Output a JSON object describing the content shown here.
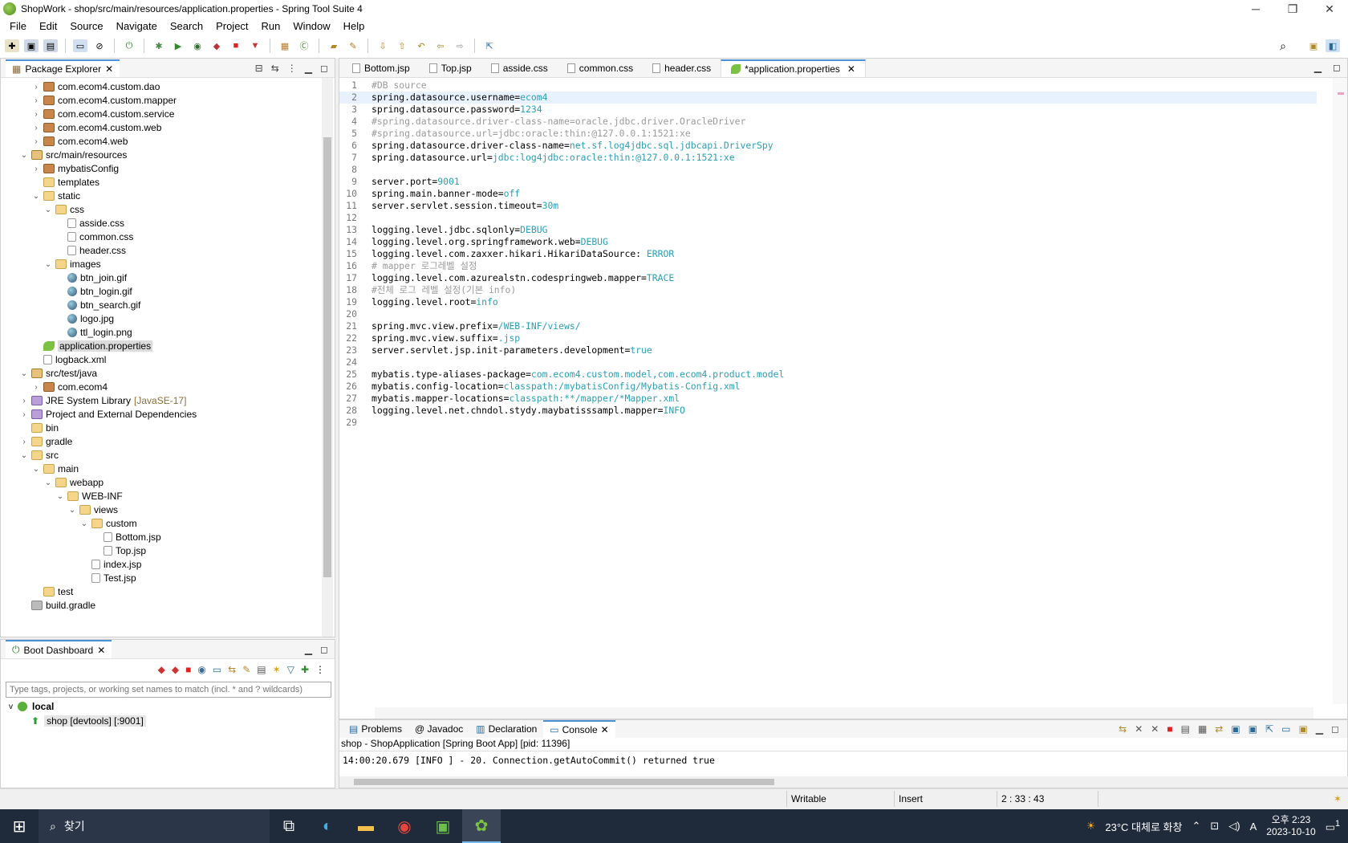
{
  "window": {
    "title": "ShopWork - shop/src/main/resources/application.properties - Spring Tool Suite 4",
    "minimize": "─",
    "maximize": "❐",
    "close": "✕"
  },
  "menu": [
    "File",
    "Edit",
    "Source",
    "Navigate",
    "Search",
    "Project",
    "Run",
    "Window",
    "Help"
  ],
  "package_explorer": {
    "title": "Package Explorer",
    "tree": [
      {
        "indent": 1,
        "twisty": ">",
        "icon": "package-icon",
        "label": "com.ecom4.custom.dao"
      },
      {
        "indent": 1,
        "twisty": ">",
        "icon": "package-icon",
        "label": "com.ecom4.custom.mapper"
      },
      {
        "indent": 1,
        "twisty": ">",
        "icon": "package-icon",
        "label": "com.ecom4.custom.service"
      },
      {
        "indent": 1,
        "twisty": ">",
        "icon": "package-icon",
        "label": "com.ecom4.custom.web"
      },
      {
        "indent": 1,
        "twisty": ">",
        "icon": "package-icon",
        "label": "com.ecom4.web"
      },
      {
        "indent": 0,
        "twisty": "v",
        "icon": "source-folder-icon",
        "label": "src/main/resources"
      },
      {
        "indent": 1,
        "twisty": ">",
        "icon": "package-icon",
        "label": "mybatisConfig"
      },
      {
        "indent": 1,
        "twisty": "",
        "icon": "folder-icon",
        "label": "templates"
      },
      {
        "indent": 1,
        "twisty": "v",
        "icon": "folder-icon",
        "label": "static"
      },
      {
        "indent": 2,
        "twisty": "v",
        "icon": "folder-icon",
        "label": "css"
      },
      {
        "indent": 3,
        "twisty": "",
        "icon": "file-icon",
        "label": "asside.css"
      },
      {
        "indent": 3,
        "twisty": "",
        "icon": "file-icon",
        "label": "common.css"
      },
      {
        "indent": 3,
        "twisty": "",
        "icon": "file-icon",
        "label": "header.css"
      },
      {
        "indent": 2,
        "twisty": "v",
        "icon": "folder-icon",
        "label": "images"
      },
      {
        "indent": 3,
        "twisty": "",
        "icon": "image-icon",
        "label": "btn_join.gif"
      },
      {
        "indent": 3,
        "twisty": "",
        "icon": "image-icon",
        "label": "btn_login.gif"
      },
      {
        "indent": 3,
        "twisty": "",
        "icon": "image-icon",
        "label": "btn_search.gif"
      },
      {
        "indent": 3,
        "twisty": "",
        "icon": "image-icon",
        "label": "logo.jpg"
      },
      {
        "indent": 3,
        "twisty": "",
        "icon": "image-icon",
        "label": "ttl_login.png"
      },
      {
        "indent": 1,
        "twisty": "",
        "icon": "properties-icon",
        "label": "application.properties",
        "selected": true
      },
      {
        "indent": 1,
        "twisty": "",
        "icon": "xml-icon",
        "label": "logback.xml"
      },
      {
        "indent": 0,
        "twisty": "v",
        "icon": "source-folder-icon",
        "label": "src/test/java"
      },
      {
        "indent": 1,
        "twisty": ">",
        "icon": "package-icon",
        "label": "com.ecom4"
      },
      {
        "indent": 0,
        "twisty": ">",
        "icon": "library-icon",
        "label": "JRE System Library",
        "suffix": "[JavaSE-17]"
      },
      {
        "indent": 0,
        "twisty": ">",
        "icon": "library-icon",
        "label": "Project and External Dependencies"
      },
      {
        "indent": 0,
        "twisty": "",
        "icon": "folder-icon",
        "label": "bin"
      },
      {
        "indent": 0,
        "twisty": ">",
        "icon": "folder-icon",
        "label": "gradle"
      },
      {
        "indent": 0,
        "twisty": "v",
        "icon": "folder-icon",
        "label": "src"
      },
      {
        "indent": 1,
        "twisty": "v",
        "icon": "folder-icon",
        "label": "main"
      },
      {
        "indent": 2,
        "twisty": "v",
        "icon": "folder-icon",
        "label": "webapp"
      },
      {
        "indent": 3,
        "twisty": "v",
        "icon": "folder-icon",
        "label": "WEB-INF"
      },
      {
        "indent": 4,
        "twisty": "v",
        "icon": "folder-icon",
        "label": "views"
      },
      {
        "indent": 5,
        "twisty": "v",
        "icon": "folder-icon",
        "label": "custom"
      },
      {
        "indent": 6,
        "twisty": "",
        "icon": "file-icon",
        "label": "Bottom.jsp"
      },
      {
        "indent": 6,
        "twisty": "",
        "icon": "file-icon",
        "label": "Top.jsp"
      },
      {
        "indent": 5,
        "twisty": "",
        "icon": "file-icon",
        "label": "index.jsp"
      },
      {
        "indent": 5,
        "twisty": "",
        "icon": "file-icon",
        "label": "Test.jsp"
      },
      {
        "indent": 1,
        "twisty": "",
        "icon": "folder-icon",
        "label": "test"
      },
      {
        "indent": 0,
        "twisty": "",
        "icon": "config-icon",
        "label": "build.gradle"
      }
    ]
  },
  "boot_dashboard": {
    "title": "Boot Dashboard",
    "filter_placeholder": "Type tags, projects, or working set names to match (incl. * and ? wildcards)",
    "local_label": "local",
    "app_label": "shop [devtools] [:9001]"
  },
  "editor": {
    "tabs": [
      {
        "label": "Bottom.jsp",
        "active": false
      },
      {
        "label": "Top.jsp",
        "active": false
      },
      {
        "label": "asside.css",
        "active": false
      },
      {
        "label": "common.css",
        "active": false
      },
      {
        "label": "header.css",
        "active": false
      },
      {
        "label": "*application.properties",
        "active": true
      }
    ],
    "lines": [
      {
        "n": "1",
        "comment": "#DB source"
      },
      {
        "n": "2",
        "key": "spring.datasource.username=",
        "value": "ecom4",
        "current": true
      },
      {
        "n": "3",
        "key": "spring.datasource.password=",
        "value": "1234"
      },
      {
        "n": "4",
        "comment": "#spring.datasource.driver-class-name=oracle.jdbc.driver.OracleDriver"
      },
      {
        "n": "5",
        "comment": "#spring.datasource.url=jdbc:oracle:thin:@127.0.0.1:1521:xe"
      },
      {
        "n": "6",
        "key": "spring.datasource.driver-class-name=",
        "value": "net.sf.log4jdbc.sql.jdbcapi.DriverSpy"
      },
      {
        "n": "7",
        "key": "spring.datasource.url=",
        "value": "jdbc:log4jdbc:oracle:thin:@127.0.0.1:1521:xe"
      },
      {
        "n": "8"
      },
      {
        "n": "9",
        "key": "server.port=",
        "value": "9001"
      },
      {
        "n": "10",
        "key": "spring.main.banner-mode=",
        "value": "off"
      },
      {
        "n": "11",
        "key": "server.servlet.session.timeout=",
        "value": "30m"
      },
      {
        "n": "12"
      },
      {
        "n": "13",
        "key": "logging.level.jdbc.sqlonly=",
        "value": "DEBUG"
      },
      {
        "n": "14",
        "key": "logging.level.org.springframework.web=",
        "value": "DEBUG"
      },
      {
        "n": "15",
        "key": "logging.level.com.zaxxer.hikari.HikariDataSource: ",
        "value": "ERROR"
      },
      {
        "n": "16",
        "comment": "# mapper 로그레벨 설정"
      },
      {
        "n": "17",
        "key": "logging.level.com.azurealstn.codespringweb.mapper=",
        "value": "TRACE"
      },
      {
        "n": "18",
        "comment": "#전체 로그 레벨 설정(기본 info)"
      },
      {
        "n": "19",
        "key": "logging.level.root=",
        "value": "info"
      },
      {
        "n": "20"
      },
      {
        "n": "21",
        "key": "spring.mvc.view.prefix=",
        "value": "/WEB-INF/views/"
      },
      {
        "n": "22",
        "key": "spring.mvc.view.suffix=",
        "value": ".jsp"
      },
      {
        "n": "23",
        "key": "server.servlet.jsp.init-parameters.development=",
        "value": "true"
      },
      {
        "n": "24"
      },
      {
        "n": "25",
        "key": "mybatis.type-aliases-package=",
        "value": "com.ecom4.custom.model,com.ecom4.product.model"
      },
      {
        "n": "26",
        "key": "mybatis.config-location=",
        "value": "classpath:/mybatisConfig/Mybatis-Config.xml"
      },
      {
        "n": "27",
        "key": "mybatis.mapper-locations=",
        "value": "classpath:**/mapper/*Mapper.xml"
      },
      {
        "n": "28",
        "key": "logging.level.net.chndol.stydy.maybatisssampl.mapper=",
        "value": "INFO"
      },
      {
        "n": "29"
      }
    ]
  },
  "console": {
    "tabs": [
      {
        "label": "Problems",
        "active": false
      },
      {
        "label": "@ Javadoc",
        "active": false
      },
      {
        "label": "Declaration",
        "active": false
      },
      {
        "label": "Console",
        "active": true
      }
    ],
    "description": "shop - ShopApplication [Spring Boot App]  [pid: 11396]",
    "output": "14:00:20.679 [INFO ] - 20. Connection.getAutoCommit() returned true"
  },
  "status": {
    "writable": "Writable",
    "mode": "Insert",
    "position": "2 : 33 : 43"
  },
  "taskbar": {
    "search_text": "찾기",
    "weather": "23°C 대체로 화창",
    "time": "오후 2:23",
    "date": "2023-10-10",
    "ime": "A",
    "notification_count": "1"
  },
  "colors": {
    "value_teal": "#2a9fb5",
    "comment_gray": "#9a9a9a",
    "taskbar": "#1f2a3a",
    "active_tab_accent": "#4a90d9"
  }
}
